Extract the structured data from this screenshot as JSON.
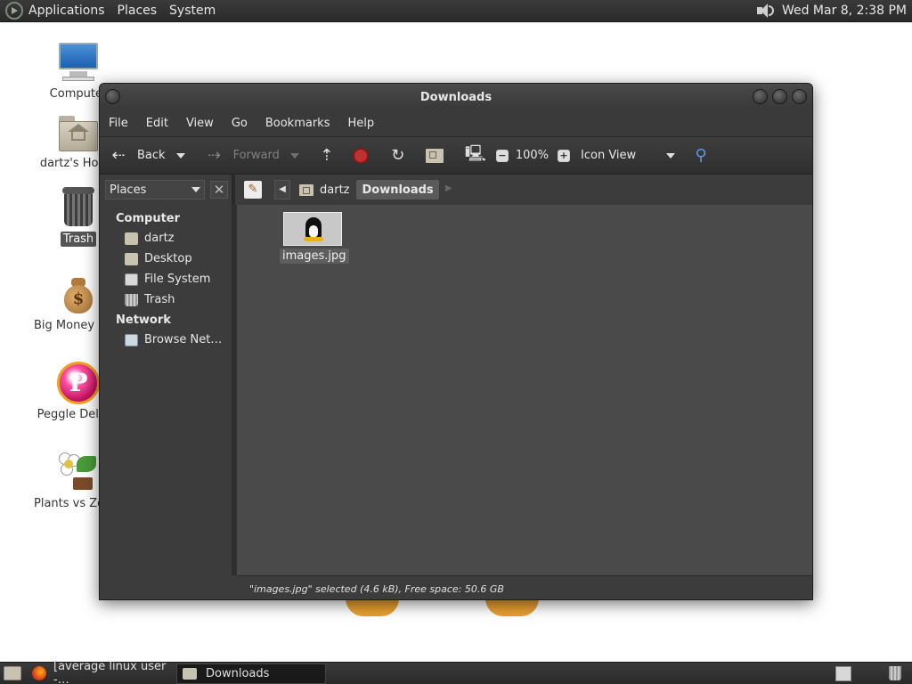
{
  "top_panel": {
    "menus": [
      "Applications",
      "Places",
      "System"
    ],
    "clock": "Wed Mar  8,  2:38 PM",
    "icons": [
      "distro-logo-icon",
      "volume-icon"
    ]
  },
  "desktop": {
    "icons": [
      {
        "label": "Computer",
        "icon": "computer-icon"
      },
      {
        "label": "dartz's Home",
        "icon": "home-folder-icon"
      },
      {
        "label": "Trash",
        "icon": "trash-icon",
        "selected": true
      },
      {
        "label": "Big Money Deluxe",
        "icon": "money-bag-icon"
      },
      {
        "label": "Peggle Deluxe",
        "icon": "peggle-icon"
      },
      {
        "label": "Plants vs Zombies",
        "icon": "plants-icon"
      }
    ]
  },
  "window": {
    "title": "Downloads",
    "menubar": [
      "File",
      "Edit",
      "View",
      "Go",
      "Bookmarks",
      "Help"
    ],
    "toolbar": {
      "back": "Back",
      "forward": "Forward",
      "zoom": "100%",
      "view_mode": "Icon View"
    },
    "sidebar": {
      "selector": "Places",
      "sections": [
        {
          "title": "Computer",
          "items": [
            "dartz",
            "Desktop",
            "File System",
            "Trash"
          ]
        },
        {
          "title": "Network",
          "items": [
            "Browse Net…"
          ]
        }
      ]
    },
    "pathbar": [
      "dartz",
      "Downloads"
    ],
    "files": [
      {
        "name": "images.jpg",
        "icon": "tux-image-thumbnail"
      }
    ],
    "status": "\"images.jpg\" selected (4.6 kB), Free space: 50.6 GB"
  },
  "bottom_panel": {
    "tasks": [
      {
        "label": "[average linux user -…",
        "icon": "firefox-icon",
        "active": false
      },
      {
        "label": "Downloads",
        "icon": "folder-icon",
        "active": true
      }
    ]
  },
  "colors": {
    "panel": "#2e2e2e",
    "window_bg": "#3c3c3c",
    "content_bg": "#4a4a4a",
    "stop_button": "#c03030"
  }
}
